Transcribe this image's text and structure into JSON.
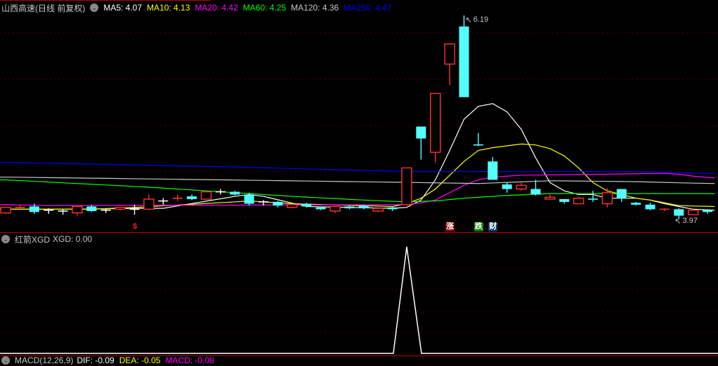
{
  "header": {
    "title": "山西高速(日线 前复权)",
    "ma": [
      {
        "label": "MA5: 4.07",
        "color": "#ffffff"
      },
      {
        "label": "MA10: 4.13",
        "color": "#ffff00"
      },
      {
        "label": "MA20: 4.42",
        "color": "#ff00ff"
      },
      {
        "label": "MA60: 4.25",
        "color": "#00ff00"
      },
      {
        "label": "MA120: 4.36",
        "color": "#c8c8c8"
      },
      {
        "label": "MA250: 4.47",
        "color": "#0000ff"
      }
    ]
  },
  "indicator": {
    "name": "红箭XGD",
    "value": "XGD: 0.00"
  },
  "macd": {
    "name": "MACD(12,26,9)",
    "dif": "DIF: -0.09",
    "dea": "DEA: -0.05",
    "macd": "MACD: -0.08"
  },
  "markers": {
    "high_label": "6.19",
    "low_label": "3.97"
  },
  "signals": [
    {
      "text": "$",
      "index": 9,
      "color": "#ff2020",
      "bg": "transparent"
    },
    {
      "text": "涨",
      "index": 31,
      "color": "#ffffff",
      "bg": "#8b0000"
    },
    {
      "text": "跌",
      "index": 33,
      "color": "#ffffff",
      "bg": "#008000"
    },
    {
      "text": "财",
      "index": 34,
      "color": "#ffffff",
      "bg": "#0b3d6b"
    }
  ],
  "colors": {
    "up": "#ff3232",
    "down": "#54ffff",
    "flat": "#ffffff",
    "grid": "#8b0000",
    "border": "#b00000"
  },
  "chart_data": {
    "type": "candlestick",
    "ylim": [
      3.85,
      6.35
    ],
    "candles": [
      [
        4.04,
        4.1,
        4.1,
        4.03
      ],
      [
        4.09,
        4.1,
        4.13,
        4.08
      ],
      [
        4.11,
        4.05,
        4.14,
        4.03
      ],
      [
        4.07,
        4.07,
        4.09,
        4.03
      ],
      [
        4.06,
        4.06,
        4.08,
        4.02
      ],
      [
        4.04,
        4.11,
        4.12,
        4.01
      ],
      [
        4.11,
        4.06,
        4.13,
        4.05
      ],
      [
        4.07,
        4.07,
        4.09,
        4.04
      ],
      [
        4.08,
        4.1,
        4.1,
        4.07
      ],
      [
        4.08,
        4.08,
        4.13,
        4.02
      ],
      [
        4.08,
        4.19,
        4.24,
        4.07
      ],
      [
        4.17,
        4.17,
        4.2,
        4.13
      ],
      [
        4.19,
        4.2,
        4.24,
        4.17
      ],
      [
        4.22,
        4.19,
        4.24,
        4.18
      ],
      [
        4.19,
        4.27,
        4.27,
        4.18
      ],
      [
        4.27,
        4.27,
        4.3,
        4.24
      ],
      [
        4.27,
        4.24,
        4.28,
        4.23
      ],
      [
        4.24,
        4.14,
        4.26,
        4.12
      ],
      [
        4.16,
        4.16,
        4.18,
        4.12
      ],
      [
        4.16,
        4.12,
        4.17,
        4.1
      ],
      [
        4.1,
        4.13,
        4.14,
        4.09
      ],
      [
        4.14,
        4.11,
        4.15,
        4.1
      ],
      [
        4.1,
        4.08,
        4.11,
        4.07
      ],
      [
        4.06,
        4.11,
        4.11,
        4.04
      ],
      [
        4.11,
        4.09,
        4.12,
        4.08
      ],
      [
        4.12,
        4.09,
        4.13,
        4.08
      ],
      [
        4.06,
        4.09,
        4.1,
        4.05
      ],
      [
        4.1,
        4.08,
        4.11,
        4.06
      ],
      [
        4.13,
        4.53,
        4.53,
        4.12
      ],
      [
        4.98,
        4.85,
        4.98,
        4.62
      ],
      [
        4.7,
        5.34,
        5.34,
        4.59
      ],
      [
        5.66,
        5.88,
        5.88,
        5.43
      ],
      [
        6.07,
        5.3,
        6.19,
        5.3
      ],
      [
        4.78,
        4.77,
        4.91,
        4.77
      ],
      [
        4.6,
        4.4,
        4.65,
        4.4
      ],
      [
        4.35,
        4.3,
        4.37,
        4.26
      ],
      [
        4.3,
        4.34,
        4.37,
        4.28
      ],
      [
        4.3,
        4.24,
        4.4,
        4.23
      ],
      [
        4.19,
        4.21,
        4.24,
        4.19
      ],
      [
        4.19,
        4.16,
        4.19,
        4.14
      ],
      [
        4.14,
        4.2,
        4.21,
        4.14
      ],
      [
        4.19,
        4.18,
        4.28,
        4.16
      ],
      [
        4.14,
        4.26,
        4.31,
        4.1
      ],
      [
        4.3,
        4.2,
        4.3,
        4.16
      ],
      [
        4.15,
        4.13,
        4.16,
        4.12
      ],
      [
        4.13,
        4.08,
        4.15,
        4.07
      ],
      [
        4.07,
        4.08,
        4.09,
        4.06
      ],
      [
        4.08,
        4.01,
        4.09,
        3.97
      ],
      [
        4.02,
        4.07,
        4.08,
        4.02
      ],
      [
        4.07,
        4.05,
        4.07,
        4.03
      ]
    ],
    "ma_lines": [
      {
        "name": "MA5",
        "color": "#ffffff",
        "points": [
          [
            0,
            4.08
          ],
          [
            5,
            4.08
          ],
          [
            9,
            4.09
          ],
          [
            11,
            4.09
          ],
          [
            16,
            4.22
          ],
          [
            17,
            4.24
          ],
          [
            18,
            4.22
          ],
          [
            21,
            4.11
          ],
          [
            27,
            4.09
          ],
          [
            28,
            4.1
          ],
          [
            29,
            4.18
          ],
          [
            30,
            4.4
          ],
          [
            31,
            4.72
          ],
          [
            32,
            5.06
          ],
          [
            33,
            5.2
          ],
          [
            34,
            5.23
          ],
          [
            35,
            5.14
          ],
          [
            36,
            4.95
          ],
          [
            37,
            4.64
          ],
          [
            38,
            4.37
          ],
          [
            39,
            4.28
          ],
          [
            40,
            4.24
          ],
          [
            41,
            4.24
          ],
          [
            42,
            4.2
          ],
          [
            44,
            4.2
          ],
          [
            45,
            4.18
          ],
          [
            46,
            4.14
          ],
          [
            47,
            4.11
          ],
          [
            48,
            4.08
          ],
          [
            49,
            4.07
          ]
        ]
      },
      {
        "name": "MA10",
        "color": "#ffff00",
        "points": [
          [
            0,
            4.08
          ],
          [
            6,
            4.08
          ],
          [
            9,
            4.1
          ],
          [
            16,
            4.16
          ],
          [
            17,
            4.17
          ],
          [
            20,
            4.14
          ],
          [
            27,
            4.11
          ],
          [
            28,
            4.14
          ],
          [
            29,
            4.2
          ],
          [
            30,
            4.3
          ],
          [
            31,
            4.45
          ],
          [
            32,
            4.6
          ],
          [
            33,
            4.72
          ],
          [
            34,
            4.75
          ],
          [
            35,
            4.77
          ],
          [
            36,
            4.79
          ],
          [
            37,
            4.78
          ],
          [
            38,
            4.74
          ],
          [
            39,
            4.66
          ],
          [
            40,
            4.53
          ],
          [
            41,
            4.37
          ],
          [
            42,
            4.28
          ],
          [
            43,
            4.24
          ],
          [
            44,
            4.2
          ],
          [
            45,
            4.18
          ],
          [
            46,
            4.15
          ],
          [
            47,
            4.12
          ],
          [
            49,
            4.11
          ]
        ]
      },
      {
        "name": "MA20",
        "color": "#ff00ff",
        "points": [
          [
            0,
            4.13
          ],
          [
            3,
            4.12
          ],
          [
            28,
            4.13
          ],
          [
            29,
            4.15
          ],
          [
            30,
            4.18
          ],
          [
            31,
            4.26
          ],
          [
            32,
            4.34
          ],
          [
            33,
            4.4
          ],
          [
            34,
            4.43
          ],
          [
            36,
            4.45
          ],
          [
            46,
            4.47
          ],
          [
            47,
            4.46
          ],
          [
            48,
            4.44
          ],
          [
            49,
            4.42
          ]
        ]
      },
      {
        "name": "MA60",
        "color": "#00ff00",
        "points": [
          [
            0,
            4.4
          ],
          [
            5,
            4.36
          ],
          [
            10,
            4.32
          ],
          [
            15,
            4.27
          ],
          [
            20,
            4.22
          ],
          [
            25,
            4.18
          ],
          [
            28,
            4.16
          ],
          [
            30,
            4.17
          ],
          [
            32,
            4.2
          ],
          [
            35,
            4.23
          ],
          [
            38,
            4.25
          ],
          [
            49,
            4.25
          ]
        ]
      },
      {
        "name": "MA120",
        "color": "#c8c8c8",
        "points": [
          [
            0,
            4.43
          ],
          [
            15,
            4.4
          ],
          [
            29,
            4.37
          ],
          [
            33,
            4.36
          ],
          [
            38,
            4.39
          ],
          [
            44,
            4.38
          ],
          [
            49,
            4.36
          ]
        ]
      },
      {
        "name": "MA250",
        "color": "#0000ff",
        "points": [
          [
            0,
            4.59
          ],
          [
            16,
            4.54
          ],
          [
            28,
            4.49
          ],
          [
            44,
            4.49
          ],
          [
            49,
            4.47
          ]
        ]
      }
    ],
    "xgd": {
      "ylim": [
        0,
        1
      ],
      "spike_index": 28,
      "spike_value": 1
    }
  }
}
